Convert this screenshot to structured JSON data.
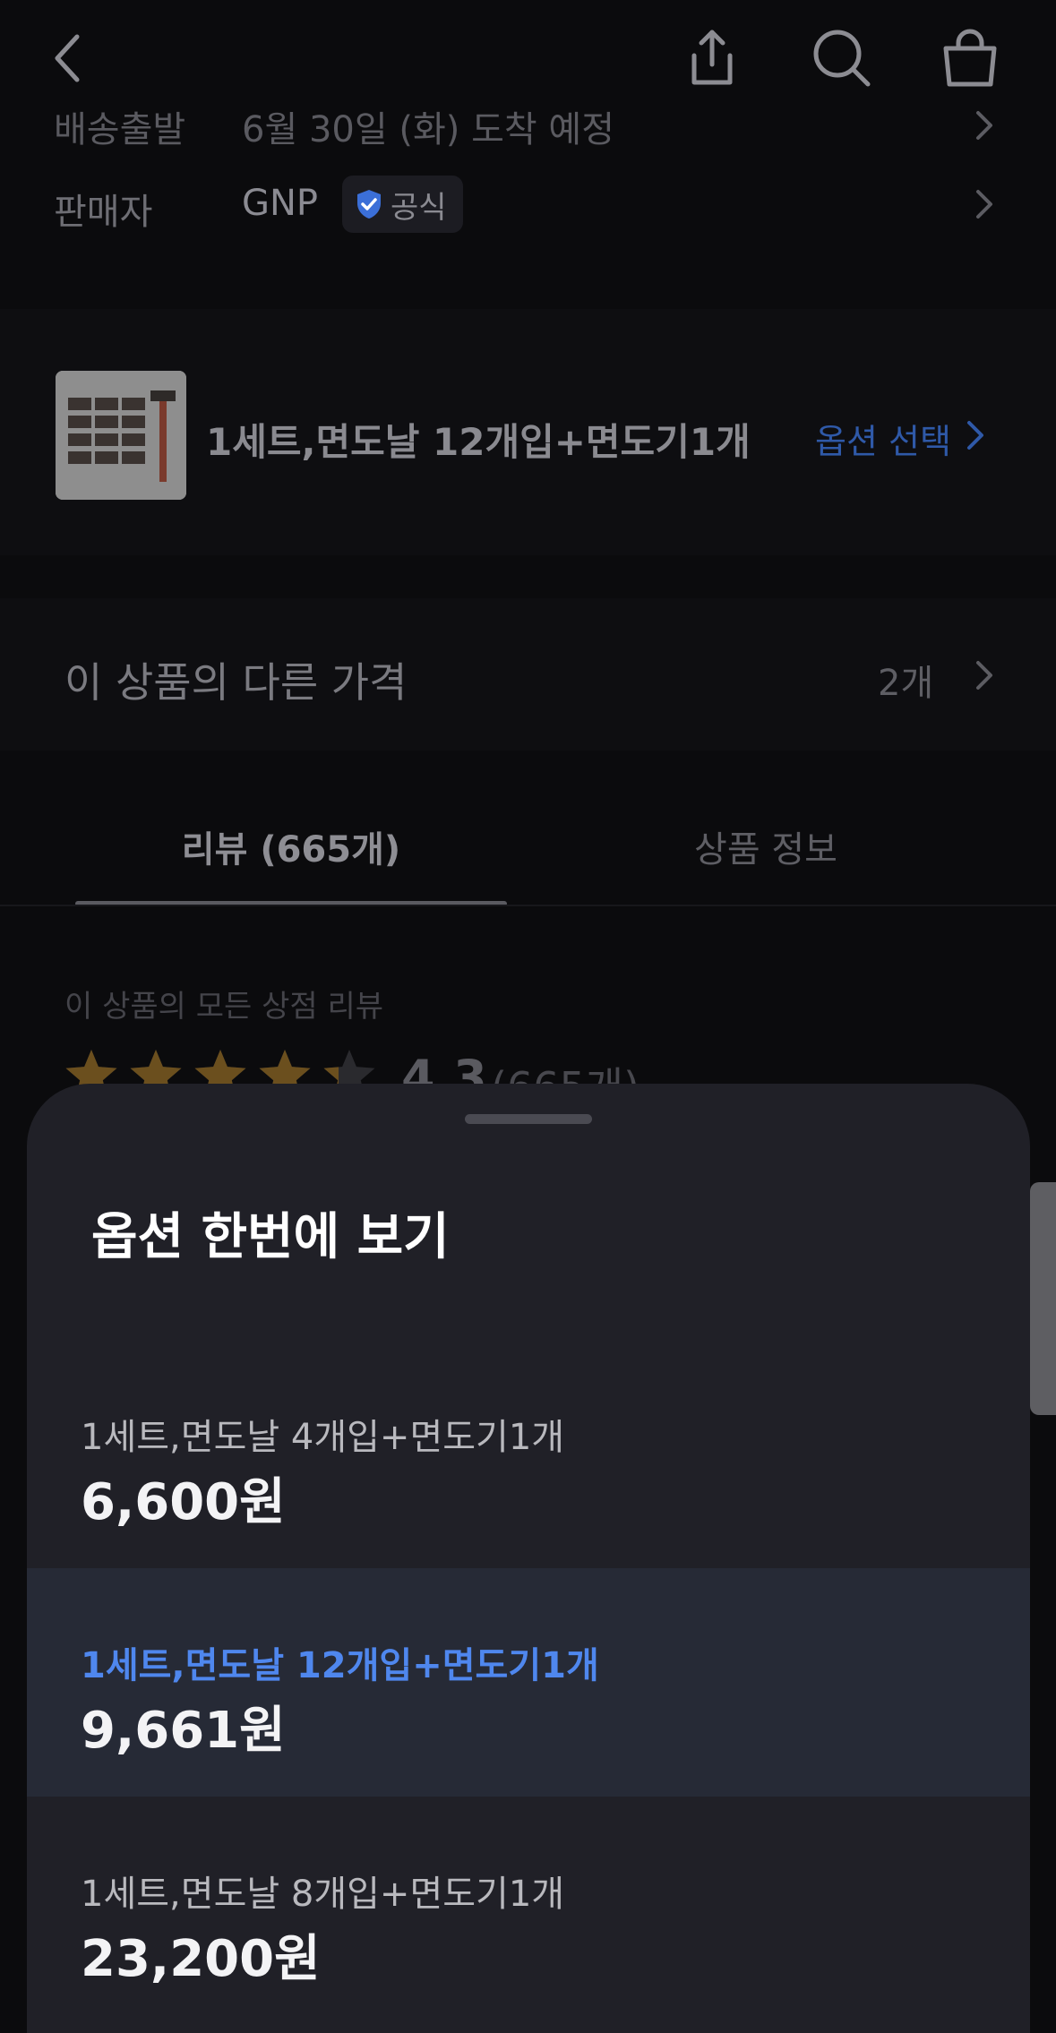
{
  "nav": {
    "back_icon": "chevron-left-icon",
    "share_icon": "share-icon",
    "search_icon": "search-icon",
    "cart_icon": "shopping-bag-icon"
  },
  "product_info": {
    "shipping_label": "배송출발",
    "shipping_value": "6월 30일 (화) 도착 예정",
    "seller_label": "판매자",
    "seller_value": "GNP",
    "official_badge": "공식"
  },
  "option_card": {
    "selected_option": "1세트,면도날 12개입+면도기1개",
    "select_label": "옵션 선택"
  },
  "other_prices": {
    "label": "이 상품의 다른 가격",
    "count": "2개"
  },
  "tabs": [
    {
      "label": "리뷰 (665개)",
      "active": true
    },
    {
      "label": "상품 정보",
      "active": false
    }
  ],
  "reviews": {
    "caption": "이 상품의 모든 상점 리뷰",
    "rating": "4.3",
    "count": "(665개)",
    "stars": 4.3
  },
  "sheet": {
    "title": "옵션 한번에 보기",
    "options": [
      {
        "name": "1세트,면도날 4개입+면도기1개",
        "price": "6,600원",
        "selected": false
      },
      {
        "name": "1세트,면도날 12개입+면도기1개",
        "price": "9,661원",
        "selected": true
      },
      {
        "name": "1세트,면도날 8개입+면도기1개",
        "price": "23,200원",
        "selected": false
      }
    ]
  },
  "colors": {
    "accent": "#4f87ee",
    "sheet_bg": "#202027",
    "selected_row_bg": "#262a36",
    "star": "#6b4f1e"
  }
}
